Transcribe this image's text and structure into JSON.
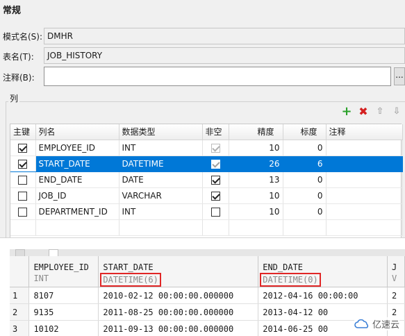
{
  "dialog": {
    "section_title": "常规",
    "schema_label": "模式名(S):",
    "schema_value": "DMHR",
    "table_label": "表名(T):",
    "table_value": "JOB_HISTORY",
    "comment_label": "注释(B):",
    "comment_value": "",
    "comment_button": "...",
    "columns_group": "列",
    "toolbar": {
      "add_icon": "plus-icon",
      "delete_icon": "x-icon",
      "up_icon": "arrow-up-icon",
      "down_icon": "arrow-down-icon"
    }
  },
  "grid": {
    "headers": {
      "pk": "主键",
      "name": "列名",
      "type": "数据类型",
      "notnull": "非空",
      "precision": "精度",
      "scale": "标度",
      "comment": "注释"
    },
    "rows": [
      {
        "pk": true,
        "name": "EMPLOYEE_ID",
        "type": "INT",
        "notnull": true,
        "notnull_disabled": true,
        "precision": "10",
        "scale": "0",
        "comment": ""
      },
      {
        "pk": true,
        "name": "START_DATE",
        "type": "DATETIME",
        "notnull": true,
        "notnull_disabled": true,
        "precision": "26",
        "scale": "6",
        "comment": ""
      },
      {
        "pk": false,
        "name": "END_DATE",
        "type": "DATE",
        "notnull": true,
        "notnull_disabled": false,
        "precision": "13",
        "scale": "0",
        "comment": ""
      },
      {
        "pk": false,
        "name": "JOB_ID",
        "type": "VARCHAR",
        "notnull": true,
        "notnull_disabled": false,
        "precision": "10",
        "scale": "0",
        "comment": ""
      },
      {
        "pk": false,
        "name": "DEPARTMENT_ID",
        "type": "INT",
        "notnull": false,
        "notnull_disabled": false,
        "precision": "10",
        "scale": "0",
        "comment": ""
      }
    ],
    "selected_row": 1,
    "selection_color": "#0078d7"
  },
  "result": {
    "columns": [
      {
        "name": "EMPLOYEE_ID",
        "type": "INT",
        "highlight": false
      },
      {
        "name": "START_DATE",
        "type": "DATETIME(6)",
        "highlight": true
      },
      {
        "name": "END_DATE",
        "type": "DATETIME(0)",
        "highlight": true
      },
      {
        "name": "J",
        "type": "V",
        "highlight": false
      }
    ],
    "rows": [
      {
        "n": "1",
        "cells": [
          "8107",
          "2010-02-12 00:00:00.000000",
          "2012-04-16 00:00:00",
          "2"
        ]
      },
      {
        "n": "2",
        "cells": [
          "9135",
          "2011-08-25 00:00:00.000000",
          "2013-04-12 00",
          "2"
        ]
      },
      {
        "n": "3",
        "cells": [
          "10102",
          "2011-09-13 00:00:00.000000",
          "2014-06-25 00",
          ""
        ]
      }
    ],
    "highlight_color": "#e02626"
  },
  "watermark": {
    "text": "亿速云",
    "icon": "cloud-logo-icon"
  }
}
